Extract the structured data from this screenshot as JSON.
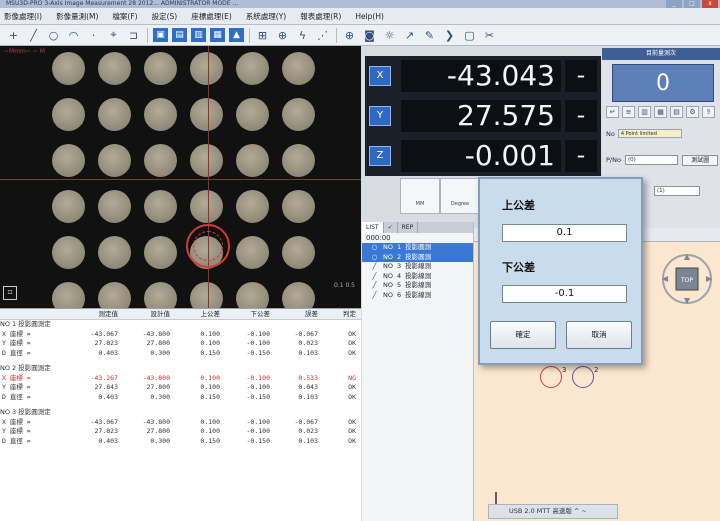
{
  "window": {
    "title": "MSU3D-PRO 3-Axis Image Measurement 28 2012... ADMINISTRATOR MODE ..."
  },
  "menu": [
    "影像處理(I)",
    "影像量測(M)",
    "檔案(F)",
    "設定(S)",
    "座標處理(E)",
    "系統處理(Y)",
    "報表處理(R)",
    "Help(H)"
  ],
  "toolbar_icons": [
    "pointer-icon",
    "line-icon",
    "circle-icon",
    "arc-icon",
    "point-icon",
    "focus-icon",
    "edge-icon",
    "blue-tool-1",
    "blue-tool-2",
    "blue-tool-3",
    "blue-tool-4",
    "blue-tool-5",
    "grid-icon",
    "cross-icon",
    "lightning-icon",
    "zigzag-icon",
    "target-icon",
    "camera-icon",
    "light-icon",
    "arrow-icon"
  ],
  "camera": {
    "label": "~Mmm~ ~ M",
    "scale_text": "0.1\n0.5"
  },
  "dro": {
    "x": {
      "axis": "X",
      "value": "-43.043",
      "sign": "-"
    },
    "y": {
      "axis": "Y",
      "value": "27.575",
      "sign": "-"
    },
    "z": {
      "axis": "Z",
      "value": "-0.001",
      "sign": "-"
    },
    "sub_buttons": [
      "MM",
      "Degree"
    ]
  },
  "right_panel": {
    "title": "目前量測次",
    "count": "0",
    "no_label": "No",
    "no_value": "4 Point limited",
    "pn_label": "P/No",
    "pn_value": "(0)",
    "pn_button": "測試圖",
    "mini_select": "(1)"
  },
  "feature_list": {
    "tabs": [
      "LIST",
      "✓",
      "REP"
    ],
    "root": "000:00",
    "items": [
      {
        "icon": "circle-icon",
        "no": "NO",
        "idx": "1",
        "name": "投影圓測",
        "selected": true
      },
      {
        "icon": "circle-icon",
        "no": "NO",
        "idx": "2",
        "name": "投影圓測",
        "selected": true
      },
      {
        "icon": "line-icon",
        "no": "NO",
        "idx": "3",
        "name": "投影線測",
        "selected": false
      },
      {
        "icon": "line-icon",
        "no": "NO",
        "idx": "4",
        "name": "投影線測",
        "selected": false
      },
      {
        "icon": "line-icon",
        "no": "NO",
        "idx": "5",
        "name": "投影線測",
        "selected": false
      },
      {
        "icon": "line-icon",
        "no": "NO",
        "idx": "6",
        "name": "投影線測",
        "selected": false
      }
    ]
  },
  "results": {
    "headers": [
      "",
      "測定值",
      "設計值",
      "上公差",
      "下公差",
      "誤差",
      "判定"
    ],
    "groups": [
      {
        "title": "NO    1  投影圓測定",
        "rows": [
          {
            "label": "X 座標",
            "eq": "=",
            "measured": "-43.067",
            "design": "-43.800",
            "upper": "0.100",
            "lower": "-0.100",
            "error": "-0.067",
            "judge": "OK",
            "red": false
          },
          {
            "label": "Y 座標",
            "eq": "=",
            "measured": "27.823",
            "design": "27.800",
            "upper": "0.100",
            "lower": "-0.100",
            "error": "0.023",
            "judge": "OK",
            "red": false
          },
          {
            "label": "D 直徑",
            "eq": "=",
            "measured": "0.403",
            "design": "0.300",
            "upper": "0.150",
            "lower": "-0.150",
            "error": "0.103",
            "judge": "OK",
            "red": false
          }
        ]
      },
      {
        "title": "NO    2  投影圓測定",
        "rows": [
          {
            "label": "X 座標",
            "eq": "=",
            "measured": "-43.267",
            "design": "-43.800",
            "upper": "0.100",
            "lower": "-0.100",
            "error": "0.533",
            "judge": "NG",
            "red": true
          },
          {
            "label": "Y 座標",
            "eq": "=",
            "measured": "27.843",
            "design": "27.800",
            "upper": "0.100",
            "lower": "-0.100",
            "error": "0.043",
            "judge": "OK",
            "red": false
          },
          {
            "label": "D 直徑",
            "eq": "=",
            "measured": "0.403",
            "design": "0.300",
            "upper": "0.150",
            "lower": "-0.150",
            "error": "0.103",
            "judge": "OK",
            "red": false
          }
        ]
      },
      {
        "title": "NO    3  投影圓測定",
        "rows": [
          {
            "label": "X 座標",
            "eq": "=",
            "measured": "-43.067",
            "design": "-43.800",
            "upper": "0.100",
            "lower": "-0.100",
            "error": "-0.067",
            "judge": "OK",
            "red": false
          },
          {
            "label": "Y 座標",
            "eq": "=",
            "measured": "27.823",
            "design": "27.800",
            "upper": "0.100",
            "lower": "-0.100",
            "error": "0.023",
            "judge": "OK",
            "red": false
          },
          {
            "label": "D 直徑",
            "eq": "=",
            "measured": "0.403",
            "design": "0.300",
            "upper": "0.150",
            "lower": "-0.150",
            "error": "0.103",
            "judge": "OK",
            "red": false
          }
        ]
      }
    ]
  },
  "graph": {
    "label_a": "3",
    "label_b": "2",
    "status": "USB 2.0 MTT 高速版 ^ ~"
  },
  "dialog": {
    "upper_label": "上公差",
    "upper_value": "0.1",
    "lower_label": "下公差",
    "lower_value": "-0.1",
    "ok_label": "確定",
    "cancel_label": "取消"
  },
  "colors": {
    "accent": "#2f69c2",
    "dialog_bg": "#c9dcec",
    "graph_bg": "#fbe6cf",
    "ng_red": "#c43030"
  }
}
